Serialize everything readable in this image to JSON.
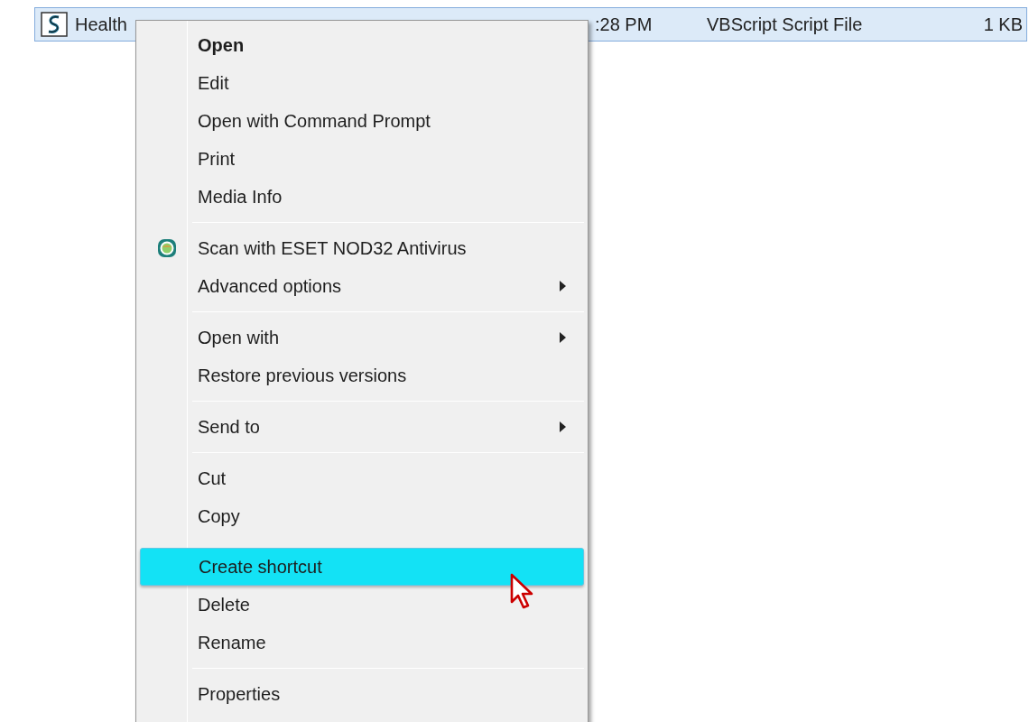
{
  "file_row": {
    "name": "Health",
    "modified": ":28 PM",
    "type": "VBScript Script File",
    "size": "1 KB",
    "selected": true
  },
  "context_menu": {
    "items": [
      {
        "kind": "item",
        "label": "Open",
        "bold": true,
        "submenu": false,
        "has_icon": false,
        "selected": false
      },
      {
        "kind": "item",
        "label": "Edit",
        "bold": false,
        "submenu": false,
        "has_icon": false,
        "selected": false
      },
      {
        "kind": "item",
        "label": "Open with Command Prompt",
        "bold": false,
        "submenu": false,
        "has_icon": false,
        "selected": false
      },
      {
        "kind": "item",
        "label": "Print",
        "bold": false,
        "submenu": false,
        "has_icon": false,
        "selected": false
      },
      {
        "kind": "item",
        "label": "Media Info",
        "bold": false,
        "submenu": false,
        "has_icon": false,
        "selected": false
      },
      {
        "kind": "separator"
      },
      {
        "kind": "item",
        "label": "Scan with ESET NOD32 Antivirus",
        "bold": false,
        "submenu": false,
        "has_icon": true,
        "selected": false
      },
      {
        "kind": "item",
        "label": "Advanced options",
        "bold": false,
        "submenu": true,
        "has_icon": false,
        "selected": false
      },
      {
        "kind": "separator"
      },
      {
        "kind": "item",
        "label": "Open with",
        "bold": false,
        "submenu": true,
        "has_icon": false,
        "selected": false
      },
      {
        "kind": "item",
        "label": "Restore previous versions",
        "bold": false,
        "submenu": false,
        "has_icon": false,
        "selected": false
      },
      {
        "kind": "separator"
      },
      {
        "kind": "item",
        "label": "Send to",
        "bold": false,
        "submenu": true,
        "has_icon": false,
        "selected": false
      },
      {
        "kind": "separator"
      },
      {
        "kind": "item",
        "label": "Cut",
        "bold": false,
        "submenu": false,
        "has_icon": false,
        "selected": false
      },
      {
        "kind": "item",
        "label": "Copy",
        "bold": false,
        "submenu": false,
        "has_icon": false,
        "selected": false
      },
      {
        "kind": "item",
        "label": "Create shortcut",
        "bold": false,
        "submenu": false,
        "has_icon": false,
        "selected": true
      },
      {
        "kind": "item",
        "label": "Delete",
        "bold": false,
        "submenu": false,
        "has_icon": false,
        "selected": false
      },
      {
        "kind": "item",
        "label": "Rename",
        "bold": false,
        "submenu": false,
        "has_icon": false,
        "selected": false
      },
      {
        "kind": "separator"
      },
      {
        "kind": "item",
        "label": "Properties",
        "bold": false,
        "submenu": false,
        "has_icon": false,
        "selected": false
      }
    ]
  }
}
